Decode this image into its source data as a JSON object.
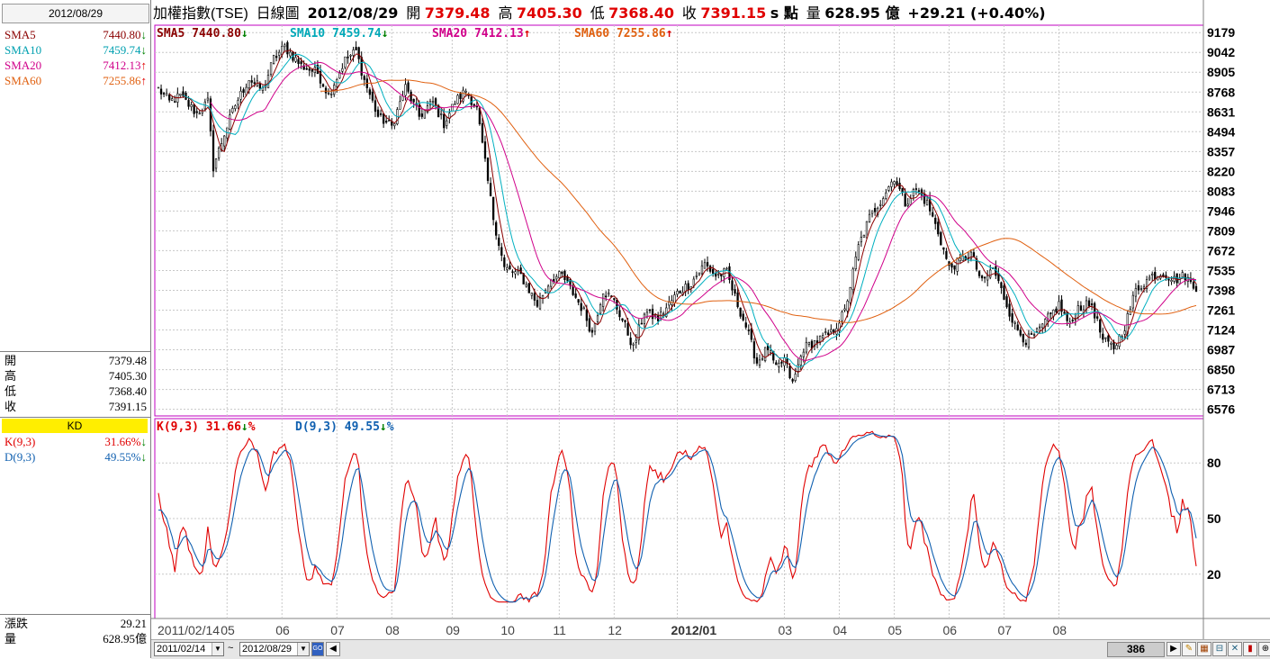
{
  "left_panel": {
    "date": "2012/08/29",
    "sma": [
      {
        "name": "SMA5",
        "value": "7440.80",
        "dir": "down",
        "color": "#8b0000"
      },
      {
        "name": "SMA10",
        "value": "7459.74",
        "dir": "down",
        "color": "#00a0b0"
      },
      {
        "name": "SMA20",
        "value": "7412.13",
        "dir": "up",
        "color": "#d0008a"
      },
      {
        "name": "SMA60",
        "value": "7255.86",
        "dir": "up",
        "color": "#e06010"
      }
    ],
    "ohlc": [
      {
        "label": "開",
        "value": "7379.48"
      },
      {
        "label": "高",
        "value": "7405.30"
      },
      {
        "label": "低",
        "value": "7368.40"
      },
      {
        "label": "收",
        "value": "7391.15"
      }
    ],
    "kd_header": "KD",
    "kd": [
      {
        "name": "K(9,3)",
        "value": "31.66%",
        "dir": "down",
        "color": "#e00000"
      },
      {
        "name": "D(9,3)",
        "value": "49.55%",
        "dir": "down",
        "color": "#1060b0"
      }
    ],
    "change": {
      "label": "漲跌",
      "value": "29.21"
    },
    "volume": {
      "label": "量",
      "value": "628.95億"
    }
  },
  "header": {
    "name": "加權指數(TSE)",
    "chart_type": "日線圖",
    "date": "2012/08/29",
    "open_label": "開",
    "open": "7379.48",
    "high_label": "高",
    "high": "7405.30",
    "low_label": "低",
    "low": "7368.40",
    "close_label": "收",
    "close": "7391.15",
    "unit": "s 點",
    "volume_label": "量",
    "volume": "628.95 億",
    "change": "+29.21 (+0.40%)"
  },
  "main_indicators": [
    {
      "text": "SMA5 7440.80",
      "arrow": "↓",
      "color": "#8b0000",
      "arrow_color": "#008000"
    },
    {
      "text": "SMA10 7459.74",
      "arrow": "↓",
      "color": "#00a8b8",
      "arrow_color": "#008000"
    },
    {
      "text": "SMA20 7412.13",
      "arrow": "↑",
      "color": "#d0008a",
      "arrow_color": "#e00000"
    },
    {
      "text": "SMA60 7255.86",
      "arrow": "↑",
      "color": "#e06010",
      "arrow_color": "#e00000"
    }
  ],
  "kd_indicators": [
    {
      "text": "K(9,3) 31.66",
      "arrow": "↓",
      "suffix": "%",
      "color": "#e00000",
      "arrow_color": "#008000"
    },
    {
      "text": "D(9,3) 49.55",
      "arrow": "↓",
      "suffix": "%",
      "color": "#1060b0",
      "arrow_color": "#008000"
    }
  ],
  "chart_data": [
    {
      "type": "line",
      "title": "加權指數(TSE) 日線圖",
      "y_ticks": [
        9179,
        9042,
        8905,
        8768,
        8631,
        8494,
        8357,
        8220,
        8083,
        7946,
        7809,
        7672,
        7535,
        7398,
        7261,
        7124,
        6987,
        6850,
        6713,
        6576
      ],
      "ylim": [
        6530,
        9230
      ],
      "x_tick_labels": [
        "2011/02/14",
        "05",
        "06",
        "07",
        "08",
        "09",
        "10",
        "11",
        "12",
        "2012/01",
        "03",
        "04",
        "05",
        "06",
        "07",
        "08"
      ],
      "x_tick_index": [
        0,
        25,
        45,
        65,
        85,
        107,
        127,
        146,
        166,
        189,
        228,
        248,
        268,
        288,
        308,
        328
      ],
      "n_days": 379,
      "close_anchors": [
        [
          0,
          8790
        ],
        [
          4,
          8700
        ],
        [
          8,
          8740
        ],
        [
          14,
          8620
        ],
        [
          18,
          8700
        ],
        [
          20,
          8250
        ],
        [
          24,
          8480
        ],
        [
          28,
          8680
        ],
        [
          33,
          8860
        ],
        [
          38,
          8780
        ],
        [
          42,
          9000
        ],
        [
          46,
          9080
        ],
        [
          52,
          8950
        ],
        [
          58,
          8900
        ],
        [
          62,
          8750
        ],
        [
          68,
          8990
        ],
        [
          72,
          9050
        ],
        [
          75,
          8850
        ],
        [
          80,
          8600
        ],
        [
          85,
          8530
        ],
        [
          90,
          8800
        ],
        [
          95,
          8600
        ],
        [
          100,
          8700
        ],
        [
          104,
          8550
        ],
        [
          108,
          8700
        ],
        [
          112,
          8780
        ],
        [
          116,
          8650
        ],
        [
          118,
          8400
        ],
        [
          122,
          7900
        ],
        [
          126,
          7550
        ],
        [
          132,
          7500
        ],
        [
          138,
          7300
        ],
        [
          143,
          7480
        ],
        [
          147,
          7500
        ],
        [
          152,
          7350
        ],
        [
          155,
          7250
        ],
        [
          158,
          7100
        ],
        [
          162,
          7400
        ],
        [
          166,
          7320
        ],
        [
          170,
          7150
        ],
        [
          173,
          7000
        ],
        [
          177,
          7250
        ],
        [
          182,
          7200
        ],
        [
          186,
          7300
        ],
        [
          189,
          7380
        ],
        [
          194,
          7450
        ],
        [
          199,
          7580
        ],
        [
          203,
          7500
        ],
        [
          207,
          7520
        ],
        [
          210,
          7350
        ],
        [
          214,
          7150
        ],
        [
          218,
          6900
        ],
        [
          222,
          7000
        ],
        [
          225,
          6850
        ],
        [
          228,
          6920
        ],
        [
          231,
          6750
        ],
        [
          235,
          7000
        ],
        [
          240,
          7050
        ],
        [
          245,
          7100
        ],
        [
          250,
          7250
        ],
        [
          255,
          7700
        ],
        [
          259,
          7900
        ],
        [
          264,
          8050
        ],
        [
          268,
          8180
        ],
        [
          272,
          8000
        ],
        [
          276,
          8100
        ],
        [
          280,
          8000
        ],
        [
          284,
          7800
        ],
        [
          288,
          7550
        ],
        [
          292,
          7600
        ],
        [
          296,
          7650
        ],
        [
          300,
          7450
        ],
        [
          304,
          7550
        ],
        [
          308,
          7350
        ],
        [
          312,
          7150
        ],
        [
          316,
          7050
        ],
        [
          320,
          7100
        ],
        [
          324,
          7200
        ],
        [
          328,
          7300
        ],
        [
          332,
          7150
        ],
        [
          335,
          7280
        ],
        [
          340,
          7300
        ],
        [
          344,
          7050
        ],
        [
          348,
          7000
        ],
        [
          352,
          7150
        ],
        [
          356,
          7400
        ],
        [
          362,
          7500
        ],
        [
          366,
          7520
        ],
        [
          370,
          7470
        ],
        [
          374,
          7500
        ],
        [
          378,
          7391
        ]
      ],
      "kd_ylim": [
        0,
        100
      ],
      "kd_y_ticks": [
        80,
        50,
        20
      ],
      "K_final": 31.66,
      "D_final": 49.55
    }
  ],
  "bottom": {
    "start_date": "2011/02/14",
    "tilde": "~",
    "end_date": "2012/08/29",
    "go_label": "GO",
    "count": "386"
  }
}
